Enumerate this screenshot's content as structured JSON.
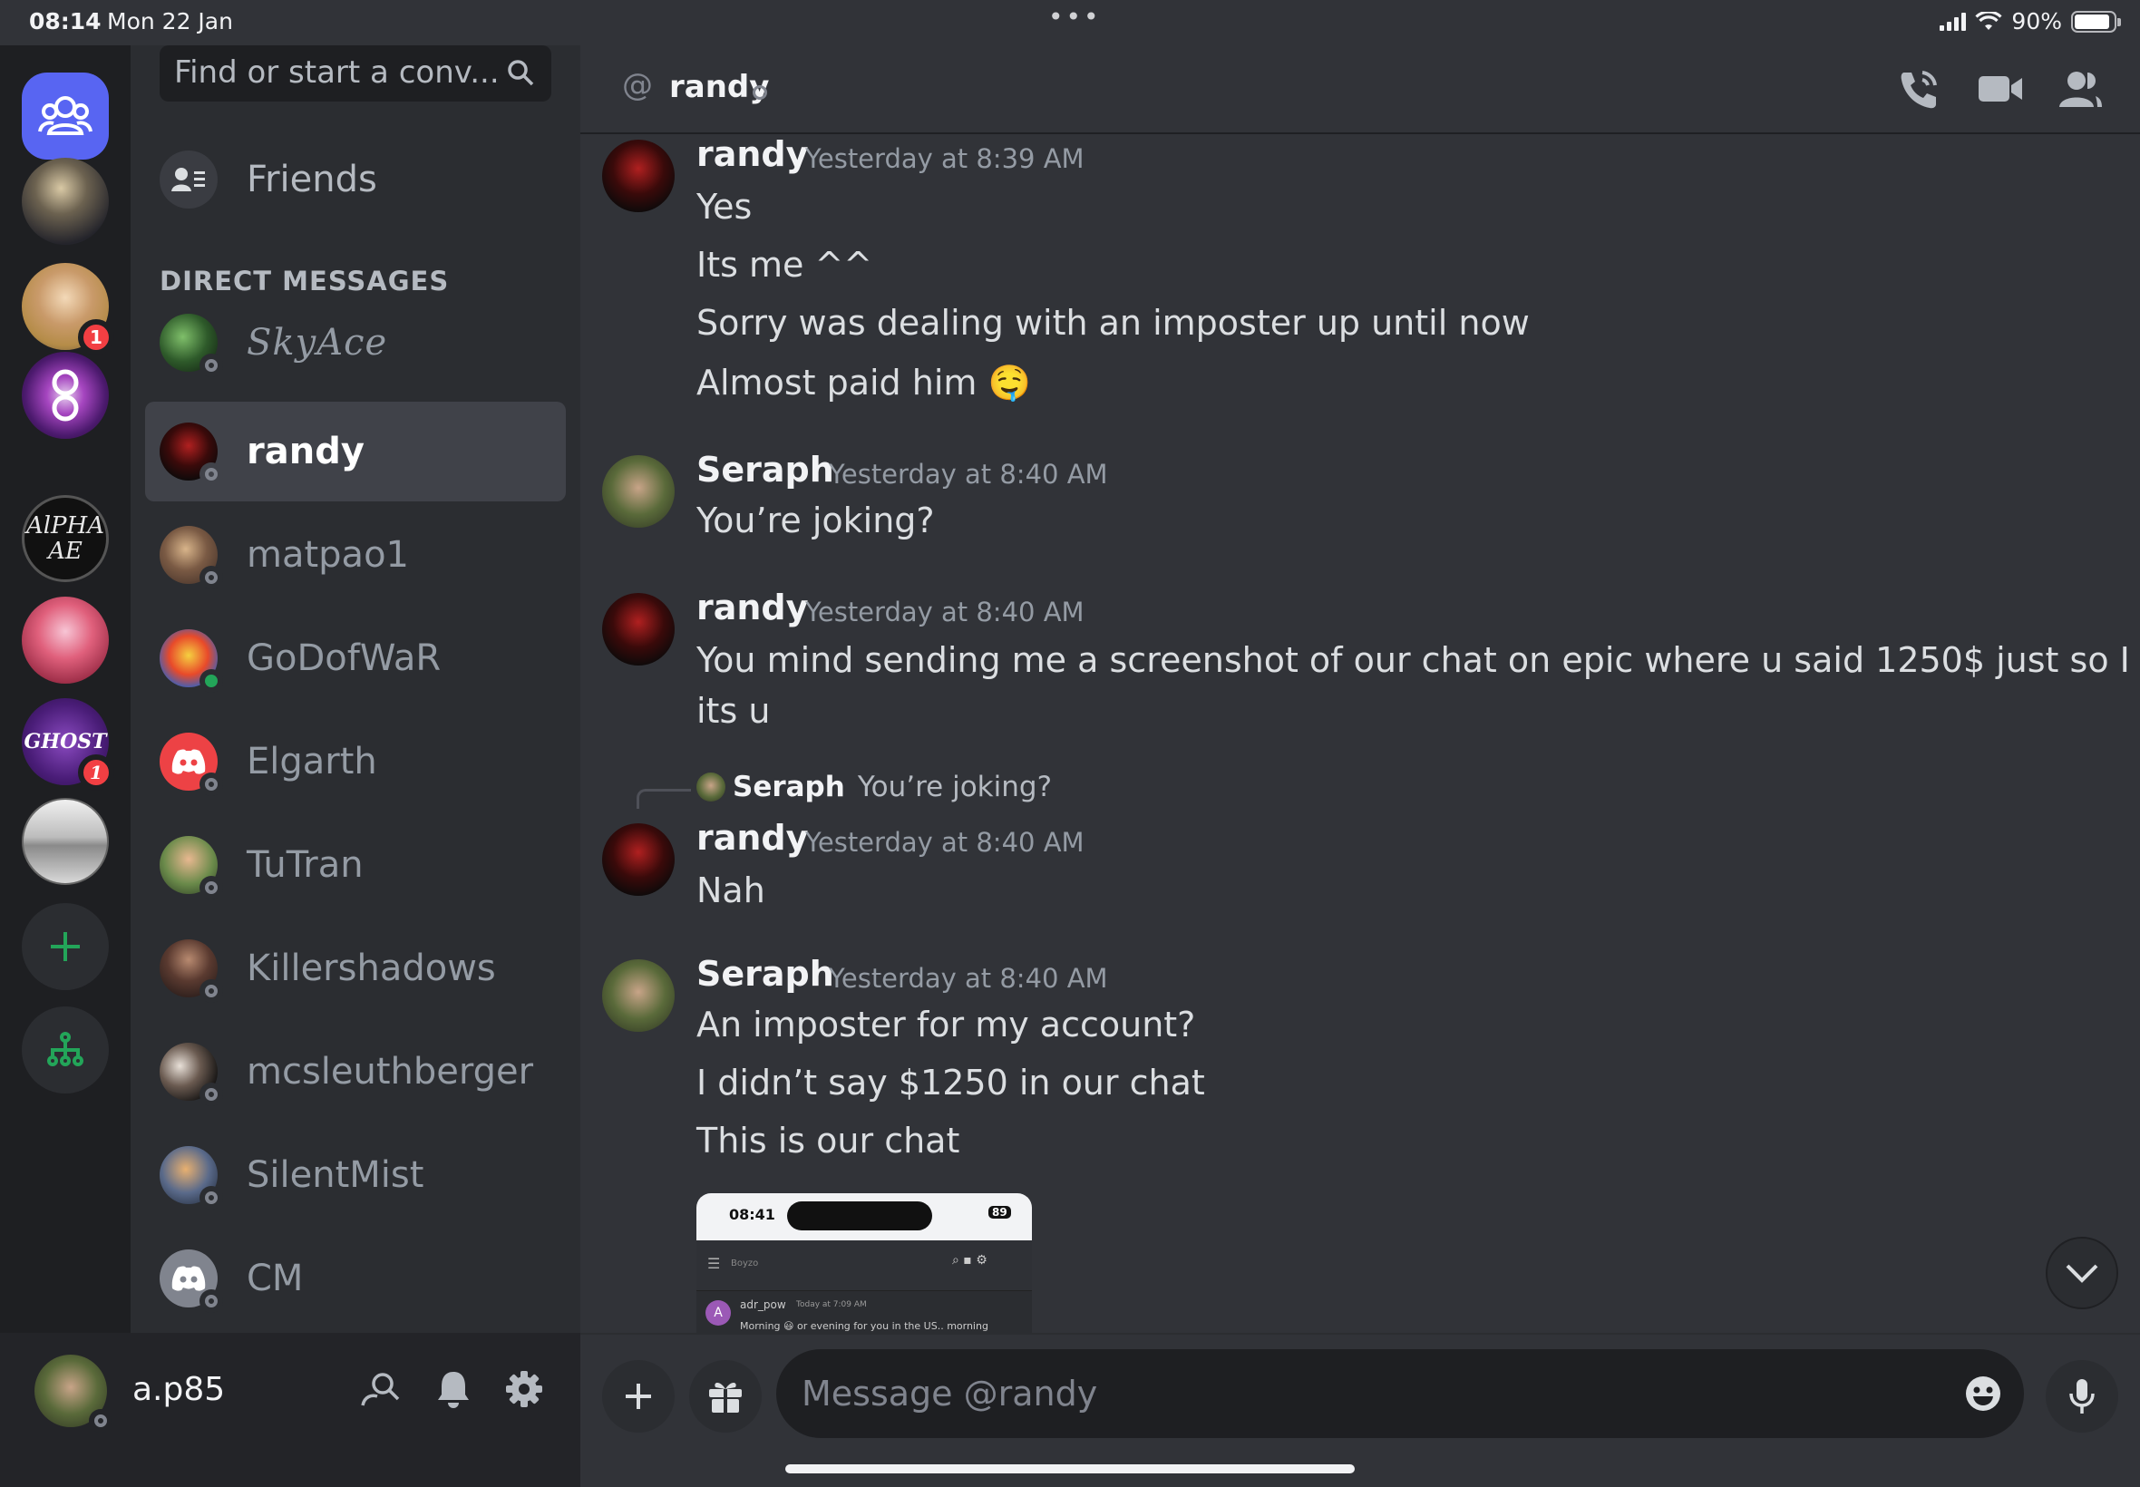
{
  "status_bar": {
    "time": "08:14",
    "date": "Mon 22 Jan",
    "battery": "90%"
  },
  "servers": [
    {
      "name": "server-1",
      "badge": ""
    },
    {
      "name": "server-2",
      "badge": "1"
    },
    {
      "name": "server-3",
      "badge": ""
    },
    {
      "name": "server-4",
      "badge": ""
    },
    {
      "name": "server-5",
      "badge": ""
    },
    {
      "name": "server-6",
      "badge": "1"
    },
    {
      "name": "server-7",
      "badge": ""
    }
  ],
  "sidebar": {
    "search_placeholder": "Find or start a conv...",
    "friends_label": "Friends",
    "dm_header": "DIRECT MESSAGES",
    "dms": [
      {
        "name": "SkyAce",
        "status": "offline"
      },
      {
        "name": "randy",
        "status": "offline"
      },
      {
        "name": "matpao1",
        "status": "offline"
      },
      {
        "name": "GoDofWaR",
        "status": "online"
      },
      {
        "name": "Elgarth",
        "status": "offline"
      },
      {
        "name": "TuTran",
        "status": "offline"
      },
      {
        "name": "Killershadows",
        "status": "offline"
      },
      {
        "name": "mcsleuthberger",
        "status": "offline"
      },
      {
        "name": "SilentMist",
        "status": "offline"
      },
      {
        "name": "CM",
        "status": "offline"
      }
    ]
  },
  "user": {
    "name": "a.p85"
  },
  "chat": {
    "at_symbol": "@",
    "title": "randy",
    "composer_placeholder": "Message @randy",
    "messages": [
      {
        "author": "randy",
        "timestamp": "Yesterday at 8:39 AM",
        "lines": [
          "Yes",
          "Its me ^^",
          "Sorry was dealing with an imposter up until now",
          "Almost paid him 🤤"
        ]
      },
      {
        "author": "Seraph",
        "timestamp": "Yesterday at 8:40 AM",
        "lines": [
          "You’re joking?"
        ]
      },
      {
        "author": "randy",
        "timestamp": "Yesterday at 8:40 AM",
        "lines": [
          "You mind sending me a screenshot of our chat on epic where u said 1250$ just so I know",
          "its u"
        ]
      },
      {
        "reply_to_author": "Seraph",
        "reply_to_text": "You’re joking?",
        "author": "randy",
        "timestamp": "Yesterday at 8:40 AM",
        "lines": [
          "Nah"
        ]
      },
      {
        "author": "Seraph",
        "timestamp": "Yesterday at 8:40 AM",
        "lines": [
          "An imposter for my account?",
          "I didn’t say $1250 in our chat",
          "This is our chat"
        ]
      }
    ],
    "attachment": {
      "time": "08:41",
      "battery": "89",
      "channel": "Boyzo",
      "preview_author": "adr_pow",
      "preview_time": "Today at 7:09 AM",
      "preview_text": "Morning 😃 or evening for you in the US.. morning"
    }
  },
  "colors": {
    "accent": "#5865f2",
    "online": "#23a559",
    "badge": "#f23f43",
    "background": "#313338"
  }
}
